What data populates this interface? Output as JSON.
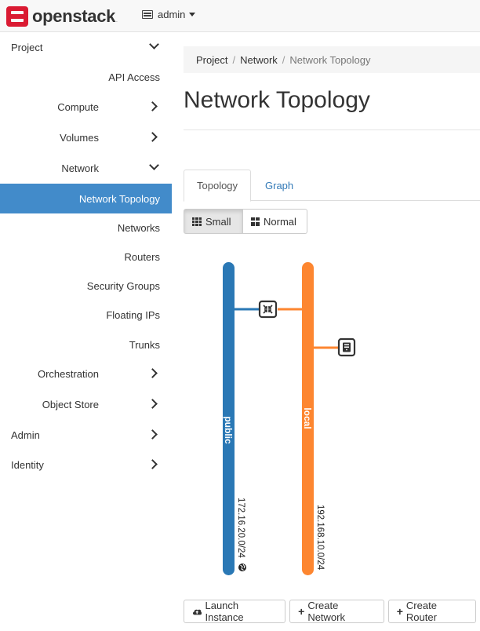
{
  "brand": {
    "name": "openstack",
    "tm": "."
  },
  "project_menu": {
    "label": "admin"
  },
  "sidebar": {
    "items": [
      {
        "label": "Project",
        "level": 0,
        "chevron": "down"
      },
      {
        "label": "API Access",
        "level": 2
      },
      {
        "label": "Compute",
        "level": 1,
        "chevron": "right"
      },
      {
        "label": "Volumes",
        "level": 1,
        "chevron": "right"
      },
      {
        "label": "Network",
        "level": 1,
        "chevron": "down"
      },
      {
        "label": "Network Topology",
        "level": 2,
        "active": true
      },
      {
        "label": "Networks",
        "level": 2
      },
      {
        "label": "Routers",
        "level": 2
      },
      {
        "label": "Security Groups",
        "level": 2
      },
      {
        "label": "Floating IPs",
        "level": 2
      },
      {
        "label": "Trunks",
        "level": 2
      },
      {
        "label": "Orchestration",
        "level": 1,
        "chevron": "right"
      },
      {
        "label": "Object Store",
        "level": 1,
        "chevron": "right"
      },
      {
        "label": "Admin",
        "level": 0,
        "chevron": "right"
      },
      {
        "label": "Identity",
        "level": 0,
        "chevron": "right"
      }
    ]
  },
  "breadcrumb": {
    "items": [
      "Project",
      "Network"
    ],
    "current": "Network Topology",
    "separator": "/"
  },
  "page_title": "Network Topology",
  "tabs": [
    {
      "label": "Topology",
      "active": true
    },
    {
      "label": "Graph",
      "active": false
    }
  ],
  "view_toggle": {
    "small": "Small",
    "normal": "Normal",
    "selected": "small"
  },
  "topology": {
    "networks": [
      {
        "name": "public",
        "cidr": "172.16.20.0/24",
        "color": "#2a78b5",
        "external": true
      },
      {
        "name": "local",
        "cidr": "192.168.10.0/24",
        "color": "#fd8630",
        "external": false
      }
    ],
    "devices": [
      {
        "type": "router",
        "icon": "router-icon"
      },
      {
        "type": "instance",
        "icon": "instance-icon"
      }
    ]
  },
  "actions": {
    "launch_instance": "Launch Instance",
    "create_network": "Create Network",
    "create_router": "Create Router"
  },
  "colors": {
    "accent": "#428bca",
    "brand": "#da1a32",
    "link": "#337ab7"
  }
}
